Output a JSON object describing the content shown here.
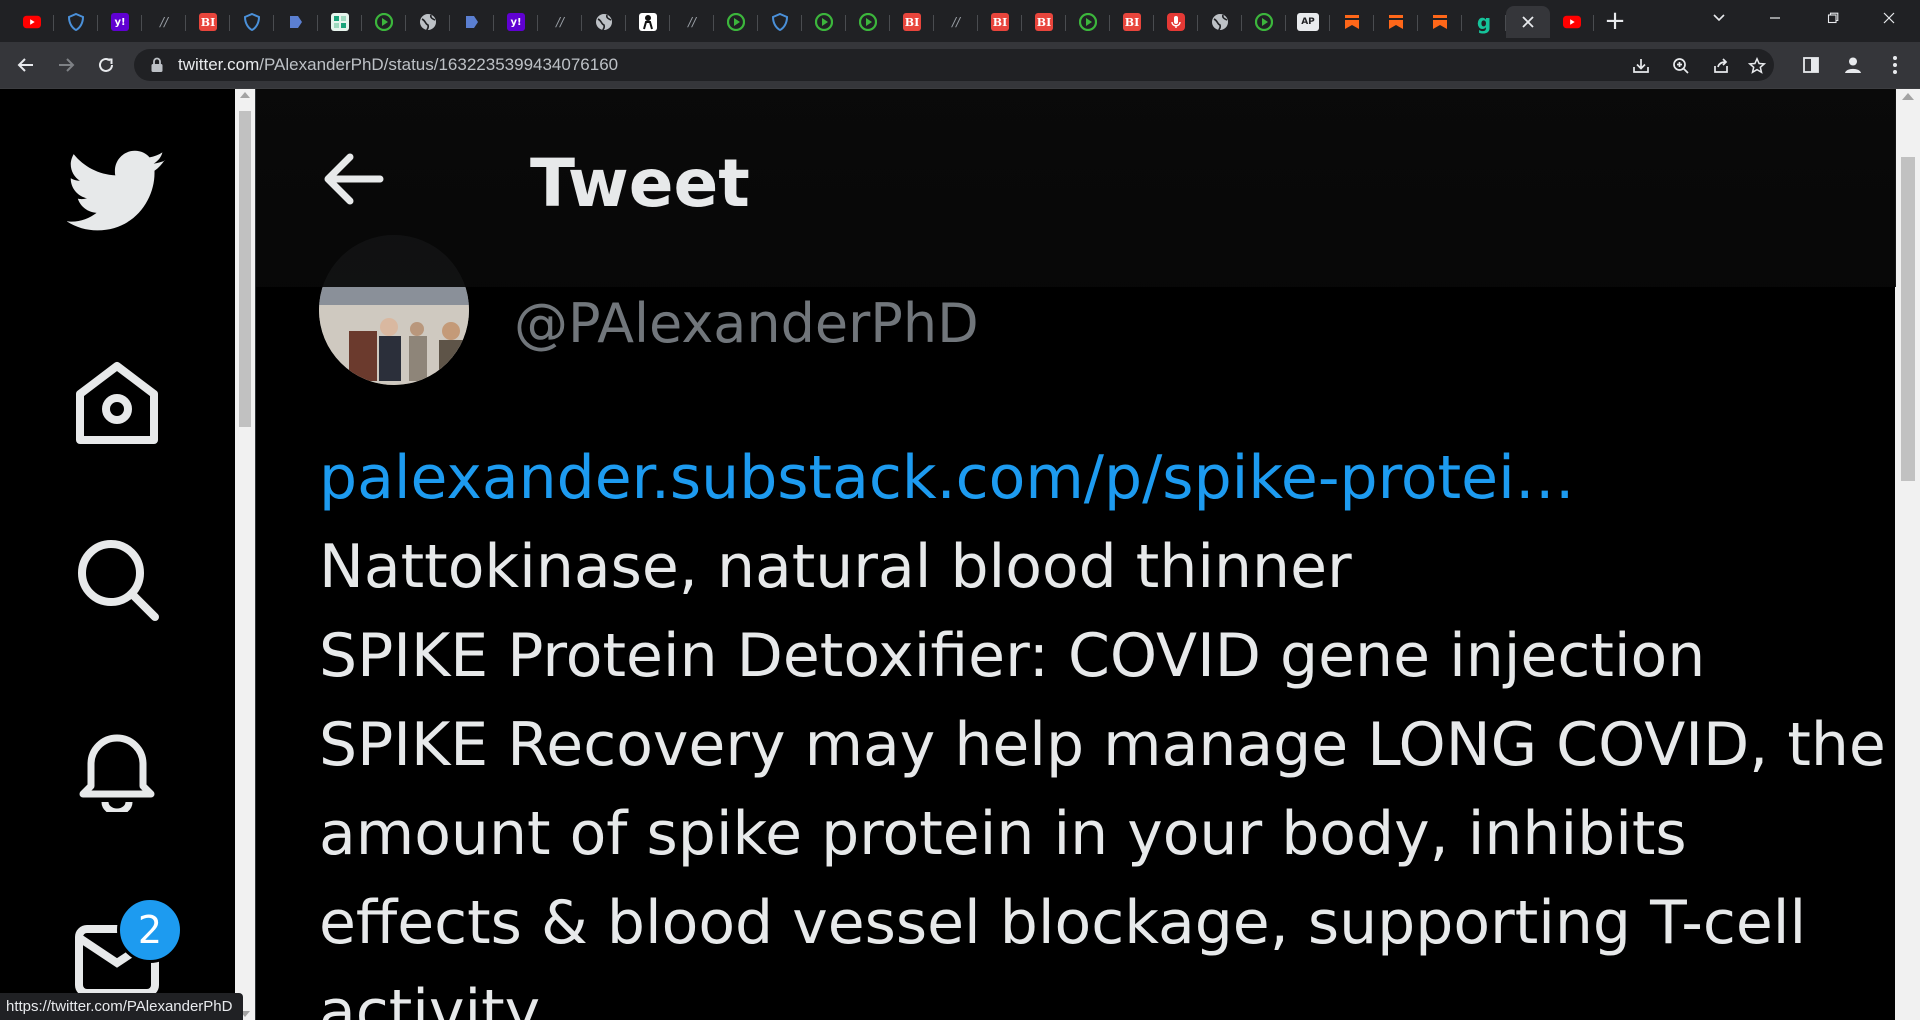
{
  "browser": {
    "tabs": [
      {
        "icon": "youtube-icon",
        "color": "#ff0000"
      },
      {
        "icon": "shield-icon",
        "color": "#4a90d9"
      },
      {
        "icon": "yahoo-icon",
        "color": "#6001d2",
        "glyph": "y!"
      },
      {
        "icon": "slash-icon",
        "color": "#9aa0a6",
        "glyph": "//"
      },
      {
        "icon": "bi-icon",
        "color": "#e8453c",
        "glyph": "BI"
      },
      {
        "icon": "shield-icon",
        "color": "#4a90d9"
      },
      {
        "icon": "flag-icon",
        "color": "#5b7fd1"
      },
      {
        "icon": "grid-icon",
        "color": "#1aa37a"
      },
      {
        "icon": "play-icon",
        "color": "#3cb63c"
      },
      {
        "icon": "globe-icon",
        "color": "#bdc1c6"
      },
      {
        "icon": "flag-icon",
        "color": "#5b7fd1"
      },
      {
        "icon": "yahoo-icon",
        "color": "#6001d2",
        "glyph": "y!"
      },
      {
        "icon": "slash-icon",
        "color": "#9aa0a6",
        "glyph": "//"
      },
      {
        "icon": "globe-icon",
        "color": "#bdc1c6"
      },
      {
        "icon": "person-icon",
        "color": "#ffffff"
      },
      {
        "icon": "slash-icon",
        "color": "#9aa0a6",
        "glyph": "//"
      },
      {
        "icon": "play-icon",
        "color": "#3cb63c"
      },
      {
        "icon": "shield-icon",
        "color": "#4a90d9"
      },
      {
        "icon": "play-icon",
        "color": "#3cb63c"
      },
      {
        "icon": "play-icon",
        "color": "#3cb63c"
      },
      {
        "icon": "bi-icon",
        "color": "#e8453c",
        "glyph": "BI"
      },
      {
        "icon": "slash-icon",
        "color": "#9aa0a6",
        "glyph": "//"
      },
      {
        "icon": "bi-icon",
        "color": "#e8453c",
        "glyph": "BI"
      },
      {
        "icon": "bi-icon",
        "color": "#e8453c",
        "glyph": "BI"
      },
      {
        "icon": "play-icon",
        "color": "#3cb63c"
      },
      {
        "icon": "bi-icon",
        "color": "#e8453c",
        "glyph": "BI"
      },
      {
        "icon": "mic-icon",
        "color": "#e53935"
      },
      {
        "icon": "globe-icon",
        "color": "#bdc1c6"
      },
      {
        "icon": "play-icon",
        "color": "#3cb63c"
      },
      {
        "icon": "news-icon",
        "color": "#ffffff",
        "glyph": "AP"
      },
      {
        "icon": "bookmark-icon",
        "color": "#ff6719"
      },
      {
        "icon": "bookmark-icon",
        "color": "#ff6719"
      },
      {
        "icon": "bookmark-icon",
        "color": "#ff6719"
      },
      {
        "icon": "grammarly-icon",
        "color": "#15c39a",
        "glyph": "g"
      },
      {
        "icon": "close-icon",
        "active": true
      },
      {
        "icon": "youtube-icon",
        "color": "#ff0000"
      }
    ],
    "new_tab_label": "+",
    "url_host": "twitter.com",
    "url_path": "/PAlexanderPhD/status/1632235399434076160",
    "status_url": "https://twitter.com/PAlexanderPhD"
  },
  "header": {
    "title": "Tweet"
  },
  "tweet": {
    "handle": "@PAlexanderPhD",
    "link": "palexander.substack.com/p/spike-protei…",
    "lines": [
      "Nattokinase, natural blood thinner",
      "SPIKE Protein Detoxifier: COVID gene injection",
      "SPIKE Recovery may help manage LONG COVID, the",
      "amount of spike protein in your body, inhibits",
      "effects & blood vessel blockage, supporting T-cell",
      "activity"
    ]
  },
  "nav": {
    "messages_badge": "2"
  },
  "colors": {
    "accent": "#1d9bf0",
    "text": "#e7e9ea",
    "muted": "#71767b",
    "background": "#000000"
  }
}
